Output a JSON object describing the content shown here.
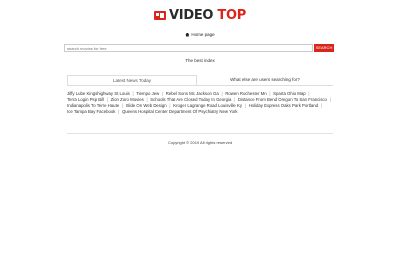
{
  "header": {
    "logo_main": "VIDEO",
    "logo_accent": "TOP",
    "logo_icon": "video-logo-icon"
  },
  "nav": {
    "home_label": "Home page",
    "home_icon": "home-icon"
  },
  "search": {
    "placeholder": "search movies for free",
    "value": "",
    "button_label": "SEARCH"
  },
  "section": {
    "title": "The best index"
  },
  "tabs": [
    {
      "label": "Latest News Today",
      "active": true
    },
    {
      "label": "What else are users searching for?",
      "active": false
    }
  ],
  "keywords": [
    "Jiffy Lube Kingshighway St Louis",
    "Tiempo Jew",
    "Rebel Sons Mc Jackson Ga",
    "Rowen Rochester Mn",
    "Sparta Ohio Map",
    "Terra Login Psp Bill",
    "Zion Zoro Movies",
    "Schools That Are Closed Today In Georgia",
    "Distance From Bend Oregon To San Francisco",
    "Indianapolis To Terre Haute",
    "Slide On Web Design",
    "Kroger Lagrange Road Louisville Ky",
    "Holiday Express Oaks Park Portland",
    "Ice Tampa Bay Facebook",
    "Queens Hospital Center Department Of Psychiatry New York"
  ],
  "footer": {
    "copyright": "Copyright © 2019 All rights reserved"
  },
  "colors": {
    "accent": "#d9261c",
    "text": "#333333",
    "border": "#dddddd"
  }
}
